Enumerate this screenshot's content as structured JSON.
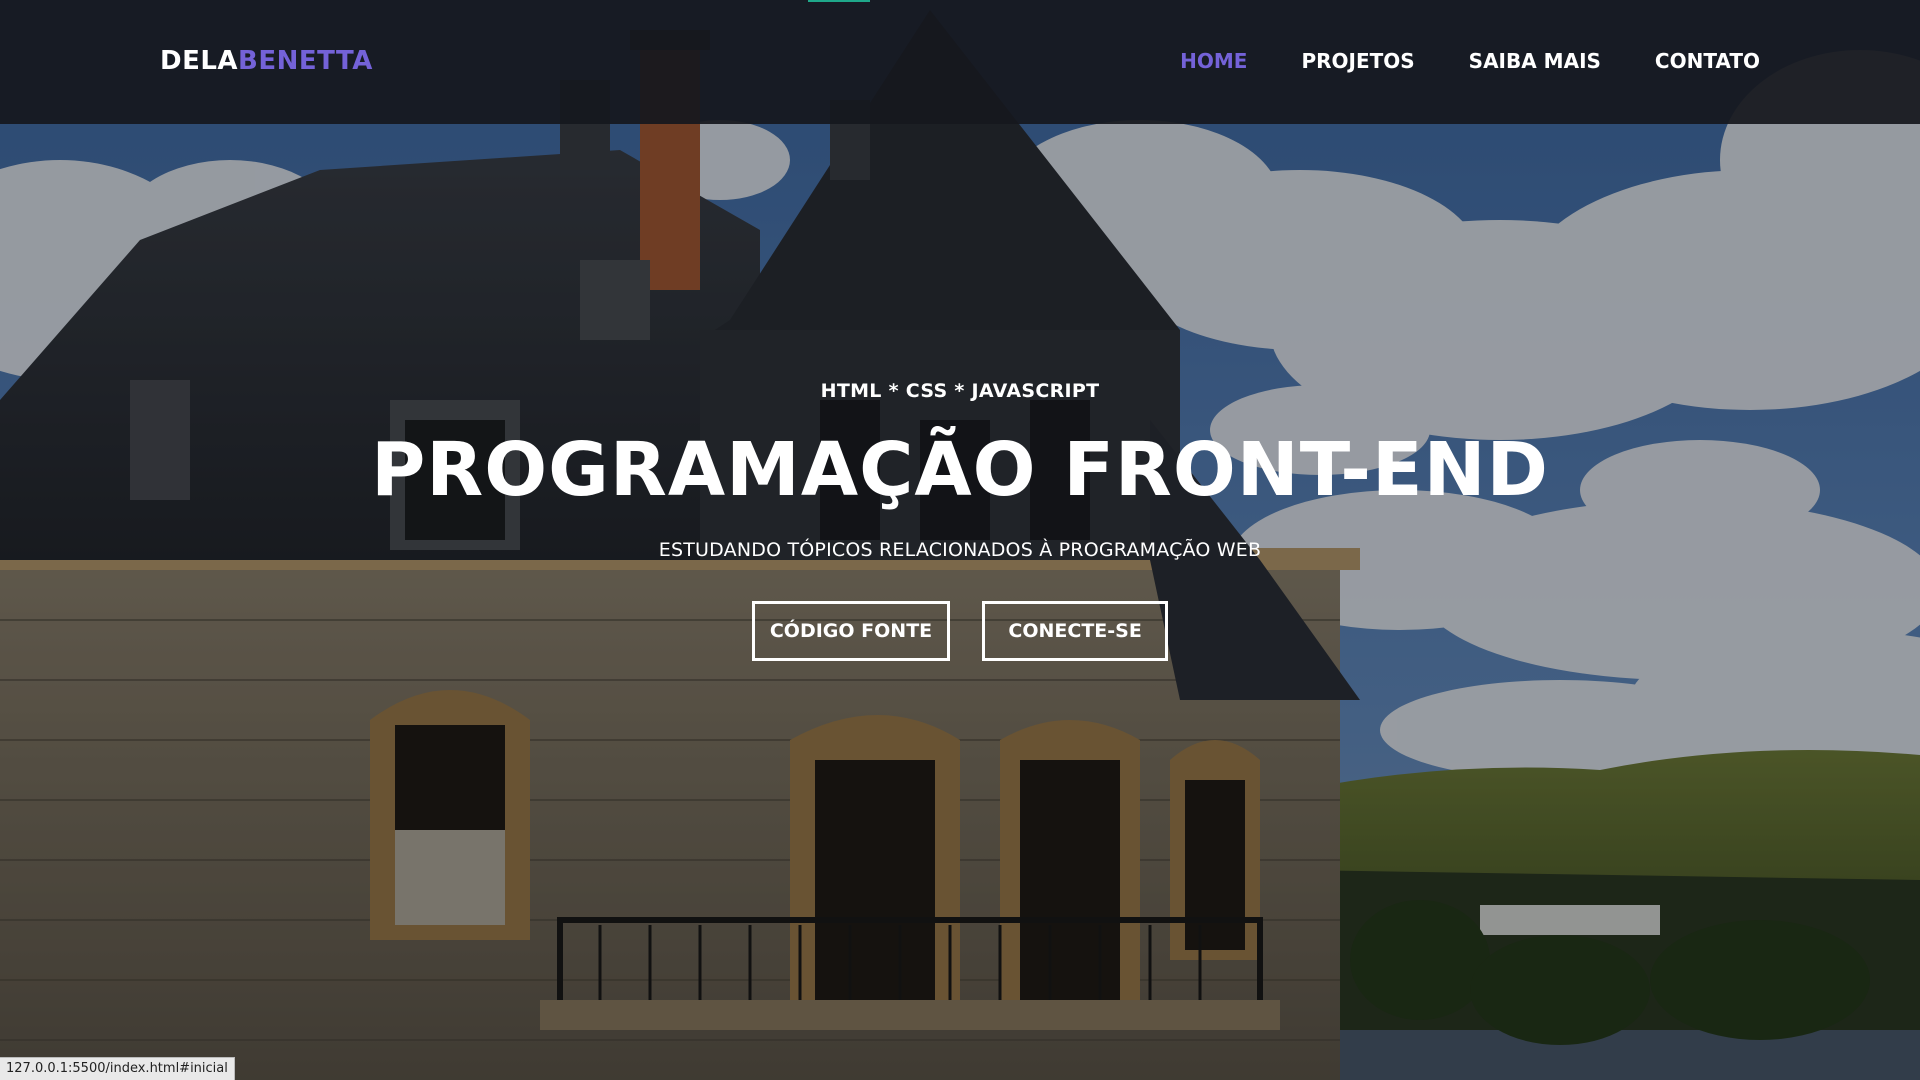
{
  "navbar": {
    "brand_part1": "DELA",
    "brand_part2": "BENETTA",
    "links": [
      {
        "label": "HOME",
        "active": true
      },
      {
        "label": "PROJETOS",
        "active": false
      },
      {
        "label": "SAIBA MAIS",
        "active": false
      },
      {
        "label": "CONTATO",
        "active": false
      }
    ]
  },
  "hero": {
    "kicker": "HTML * CSS * JAVASCRIPT",
    "title": "PROGRAMAÇÃO FRONT-END",
    "subtitle": "ESTUDANDO TÓPICOS RELACIONADOS À PROGRAMAÇÃO WEB",
    "buttons": [
      {
        "label": "CÓDIGO FONTE"
      },
      {
        "label": "CONECTE-SE"
      }
    ]
  },
  "status_bar": {
    "url": "127.0.0.1:5500/index.html#inicial"
  },
  "colors": {
    "accent": "#7462d8",
    "navbar_bg": "#16181e",
    "text": "#ffffff"
  }
}
